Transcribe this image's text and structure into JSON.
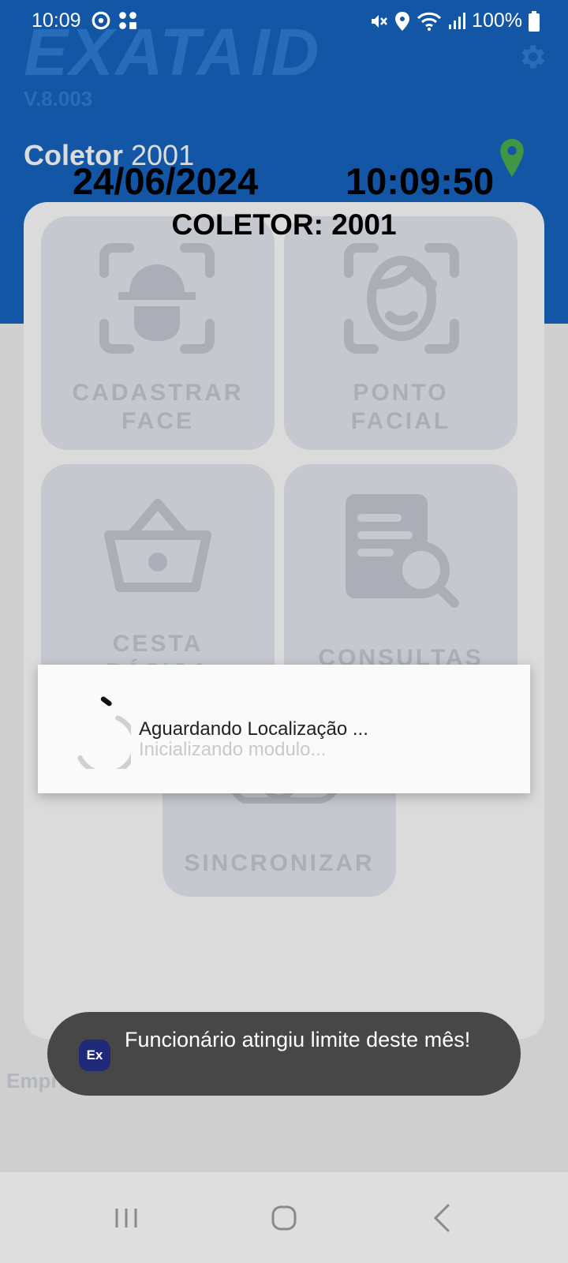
{
  "status_bar": {
    "time": "10:09",
    "battery": "100%",
    "icons": [
      "sync-icon",
      "app-notification-icon",
      "mute-icon",
      "location-icon",
      "wifi-icon",
      "signal-icon",
      "battery-icon"
    ]
  },
  "header": {
    "logo_text": "EXATA",
    "logo_suffix": "ID",
    "version": "V.8.003",
    "coletor_label": "Coletor",
    "coletor_number": "2001"
  },
  "overlay": {
    "date": "24/06/2024",
    "time": "10:09:50",
    "coletor": "COLETOR: 2001"
  },
  "tiles": {
    "cadastrar_face": "CADASTRAR\nFACE",
    "ponto_facial": "PONTO\nFACIAL",
    "cesta_basica": "CESTA\nBÁSICA",
    "consultas": "CONSULTAS",
    "sincronizar": "SINCRONIZAR"
  },
  "footer": {
    "empresa": "Empresa: ... ... ... ... ... ... ... ...RO"
  },
  "dialog": {
    "message": "Aguardando Localização ...",
    "sub_message": "Inicializando modulo..."
  },
  "toast": {
    "icon_text": "Ex",
    "message": "Funcionário atingiu limite deste mês!"
  },
  "colors": {
    "primary": "#1565c0",
    "tile_bg": "#e6e9f2",
    "toast_bg": "#474747"
  }
}
